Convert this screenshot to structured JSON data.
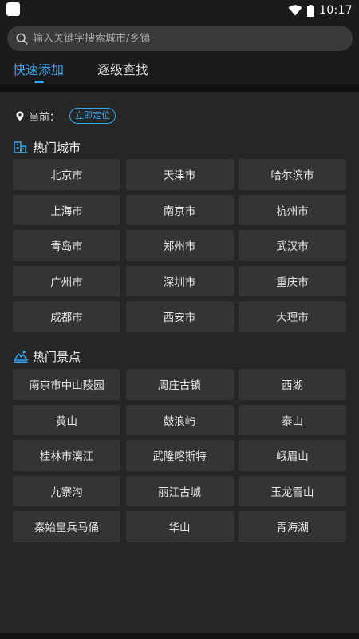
{
  "status_bar": {
    "time": "10:17"
  },
  "search": {
    "placeholder": "输入关键字搜索城市/乡镇"
  },
  "tabs": [
    {
      "label": "快速添加",
      "active": true
    },
    {
      "label": "逐级查找",
      "active": false
    }
  ],
  "location": {
    "label": "当前：",
    "locate_button": "立即定位"
  },
  "hot_cities": {
    "title": "热门城市",
    "items": [
      "北京市",
      "天津市",
      "哈尔滨市",
      "上海市",
      "南京市",
      "杭州市",
      "青岛市",
      "郑州市",
      "武汉市",
      "广州市",
      "深圳市",
      "重庆市",
      "成都市",
      "西安市",
      "大理市"
    ]
  },
  "hot_spots": {
    "title": "热门景点",
    "items": [
      "南京市中山陵园",
      "周庄古镇",
      "西湖",
      "黄山",
      "鼓浪屿",
      "泰山",
      "桂林市漓江",
      "武隆喀斯特",
      "峨眉山",
      "九寨沟",
      "丽江古城",
      "玉龙雪山",
      "秦始皇兵马俑",
      "华山",
      "青海湖"
    ]
  },
  "colors": {
    "accent": "#35a8f0",
    "background": "#1b1b1b",
    "panel": "#262626",
    "chip": "#343434"
  }
}
